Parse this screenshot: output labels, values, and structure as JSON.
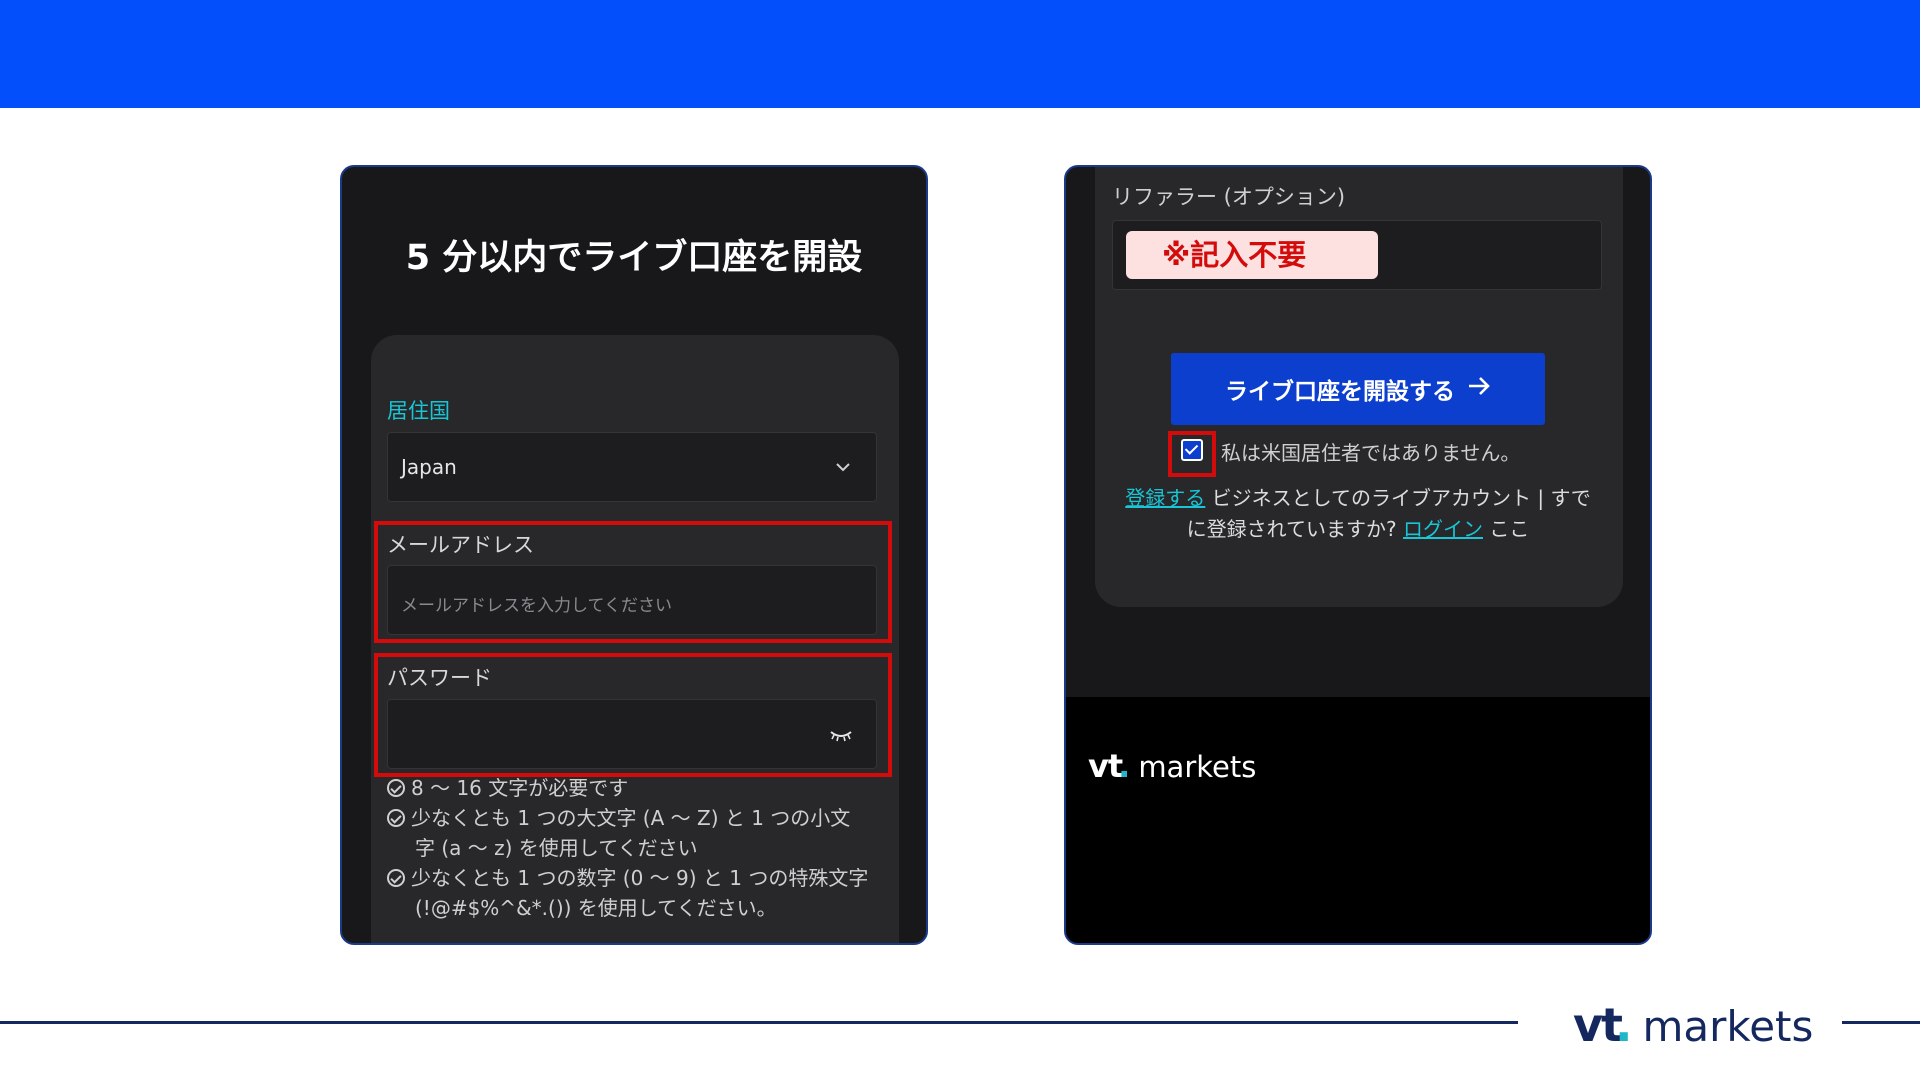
{
  "left": {
    "title": "5 分以内でライブ口座を開設",
    "country_label": "居住国",
    "country_value": "Japan",
    "email_label": "メールアドレス",
    "email_placeholder": "メールアドレスを入力してください",
    "password_label": "パスワード",
    "rules": [
      "8 〜 16 文字が必要です",
      "少なくとも 1 つの大文字 (A 〜 Z) と 1 つの小文",
      "字 (a 〜 z) を使用してください",
      "少なくとも 1 つの数字 (0 〜 9) と 1 つの特殊文字",
      "(!@#$%^&*.()) を使用してください。"
    ]
  },
  "right": {
    "referrer_label": "リファラー (オプション)",
    "referrer_note": "※記入不要",
    "open_button": "ライブ口座を開設する",
    "checkbox_text": "私は米国居住者ではありません。",
    "register_link": "登録する",
    "business_text_1": "ビジネスとしてのライブアカウント | すで",
    "business_text_2": "に登録されていますか?",
    "login_link": "ログイン",
    "here_text": "ここ",
    "logo_vt": "vt",
    "logo_markets": "markets"
  },
  "footer": {
    "logo_vt": "vt",
    "logo_markets": "markets"
  },
  "colors": {
    "brand_blue": "#024ffb",
    "highlight_red": "#d40b0b",
    "accent_cyan": "#18c6d6",
    "navy": "#14285f"
  }
}
